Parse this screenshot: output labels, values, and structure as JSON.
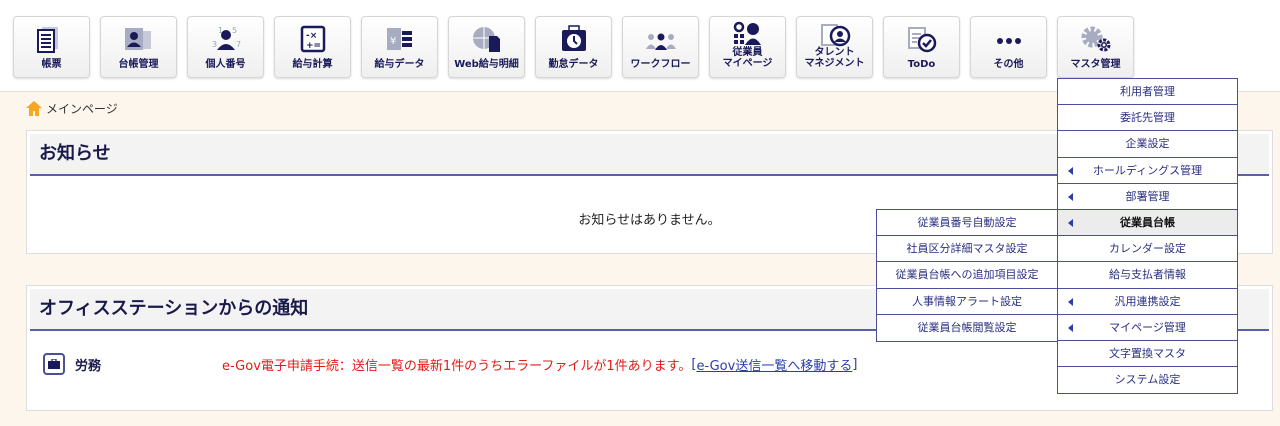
{
  "nav": [
    {
      "label": "帳票",
      "icon": "document-list-icon"
    },
    {
      "label": "台帳管理",
      "icon": "id-card-icon"
    },
    {
      "label": "個人番号",
      "icon": "person-number-icon"
    },
    {
      "label": "給与計算",
      "icon": "calculator-icon"
    },
    {
      "label": "給与データ",
      "icon": "yen-envelope-icon"
    },
    {
      "label": "Web給与明細",
      "icon": "globe-document-icon"
    },
    {
      "label": "勤怠データ",
      "icon": "clock-icon"
    },
    {
      "label": "ワークフロー",
      "icon": "people-flow-icon"
    },
    {
      "label": "従業員\nマイページ",
      "icon": "employee-gear-icon"
    },
    {
      "label": "タレント\nマネジメント",
      "icon": "clipboard-person-icon"
    },
    {
      "label": "ToDo",
      "icon": "checklist-icon"
    },
    {
      "label": "その他",
      "icon": "more-dots-icon"
    },
    {
      "label": "マスタ管理",
      "icon": "gears-icon"
    }
  ],
  "breadcrumb": {
    "label": "メインページ",
    "icon": "home-icon"
  },
  "notices": {
    "title": "お知らせ",
    "empty": "お知らせはありません。"
  },
  "office": {
    "title": "オフィスステーションからの通知",
    "category": "労務",
    "message": "e-Gov電子申請手続：送信一覧の最新1件のうちエラーファイルが1件あります。",
    "link_open": "[",
    "link": "e-Gov送信一覧へ移動する",
    "link_close": "]"
  },
  "master_menu": [
    {
      "label": "利用者管理",
      "sub": false
    },
    {
      "label": "委託先管理",
      "sub": false
    },
    {
      "label": "企業設定",
      "sub": false
    },
    {
      "label": "ホールディングス管理",
      "sub": true
    },
    {
      "label": "部署管理",
      "sub": true
    },
    {
      "label": "従業員台帳",
      "sub": true,
      "active": true
    },
    {
      "label": "カレンダー設定",
      "sub": false
    },
    {
      "label": "給与支払者情報",
      "sub": false
    },
    {
      "label": "汎用連携設定",
      "sub": true
    },
    {
      "label": "マイページ管理",
      "sub": true
    },
    {
      "label": "文字置換マスタ",
      "sub": false
    },
    {
      "label": "システム設定",
      "sub": false
    }
  ],
  "submenu": [
    {
      "label": "従業員番号自動設定"
    },
    {
      "label": "社員区分詳細マスタ設定"
    },
    {
      "label": "従業員台帳への追加項目設定"
    },
    {
      "label": "人事情報アラート設定"
    },
    {
      "label": "従業員台帳閲覧設定"
    }
  ],
  "colors": {
    "navy": "#1a1a5a",
    "accent": "#4a4f9a",
    "error": "#e61919",
    "home": "#f5a623"
  }
}
